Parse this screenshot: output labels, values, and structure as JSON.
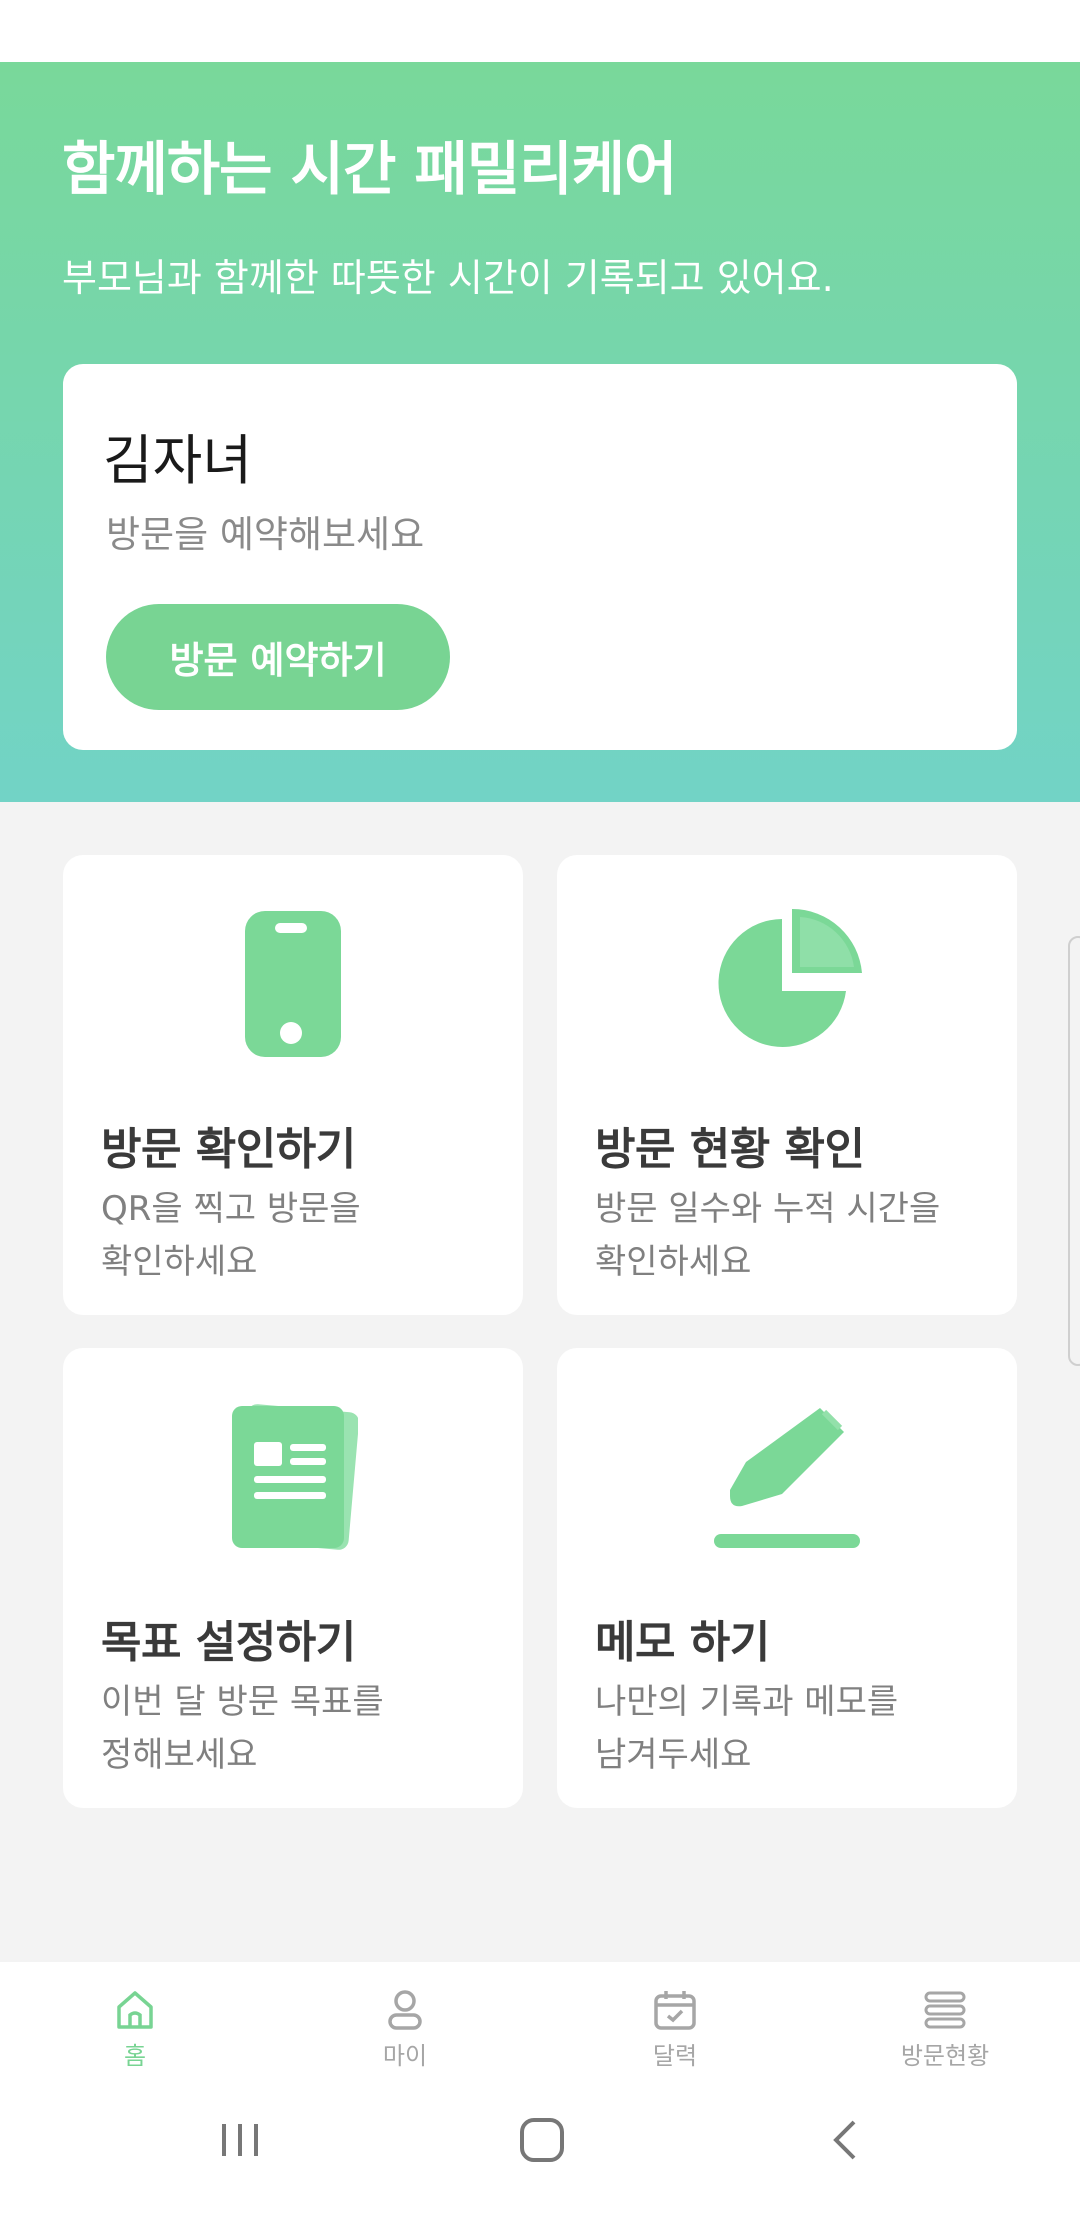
{
  "hero": {
    "title": "함께하는 시간 패밀리케어",
    "subtitle": "부모님과 함께한 따뜻한 시간이 기록되고 있어요."
  },
  "user_card": {
    "name": "김자녀",
    "hint": "방문을 예약해보세요",
    "button_label": "방문 예약하기"
  },
  "tiles": [
    {
      "title": "방문 확인하기",
      "desc": "QR을 찍고 방문을\n확인하세요",
      "icon": "phone-icon"
    },
    {
      "title": "방문 현황 확인",
      "desc": "방문 일수와 누적 시간을\n확인하세요",
      "icon": "pie-chart-icon"
    },
    {
      "title": "목표 설정하기",
      "desc": "이번 달 방문 목표를\n정해보세요",
      "icon": "document-icon"
    },
    {
      "title": "메모 하기",
      "desc": "나만의 기록과 메모를\n남겨두세요",
      "icon": "pencil-icon"
    }
  ],
  "bottom_nav": [
    {
      "label": "홈",
      "icon": "home-icon",
      "active": true
    },
    {
      "label": "마이",
      "icon": "person-icon",
      "active": false
    },
    {
      "label": "달력",
      "icon": "calendar-icon",
      "active": false
    },
    {
      "label": "방문현황",
      "icon": "list-icon",
      "active": false
    }
  ],
  "colors": {
    "accent": "#78d493",
    "hero_top": "#79d89a",
    "hero_bottom": "#72d3c6",
    "background": "#f3f3f3",
    "inactive_nav": "#a6a6a6"
  },
  "system_nav": [
    "recent-apps-icon",
    "home-circle-icon",
    "back-icon"
  ]
}
